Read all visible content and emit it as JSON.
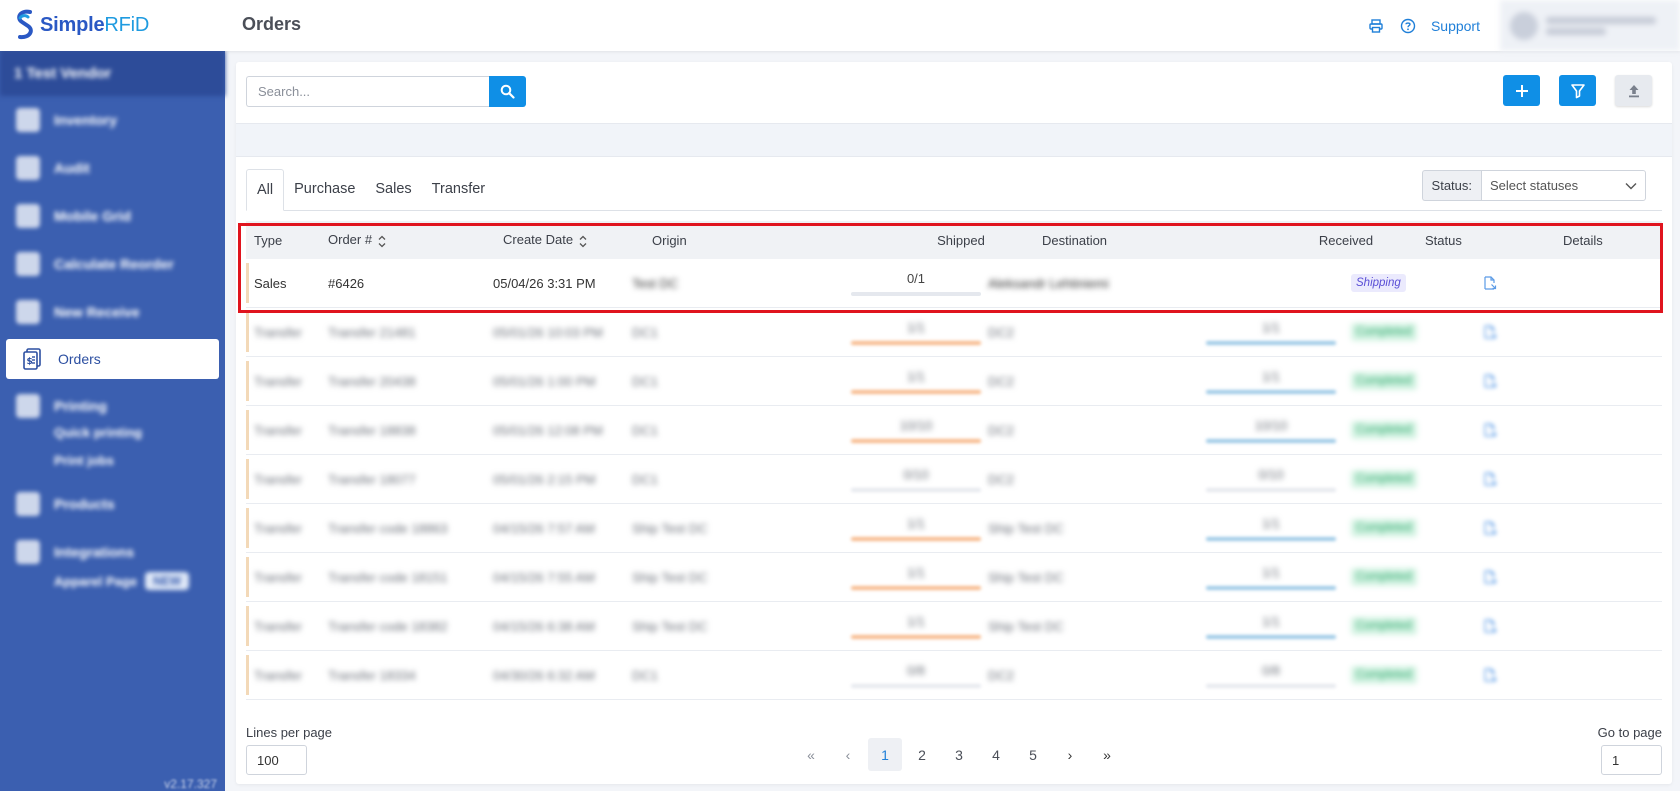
{
  "app": {
    "logo_brand": "Simple",
    "logo_suffix": "RFiD",
    "page_title": "Orders"
  },
  "header": {
    "support_label": "Support",
    "user_name": "Aleksandr Lehtiniemi",
    "user_sub": "Administrator"
  },
  "sidebar": {
    "org_name": "1 Test Vendor",
    "items": [
      {
        "label": "Inventory"
      },
      {
        "label": "Audit"
      },
      {
        "label": "Mobile Grid"
      },
      {
        "label": "Calculate Reorder"
      },
      {
        "label": "New Receive"
      },
      {
        "label": "Orders"
      },
      {
        "label": "Printing"
      },
      {
        "label": "Products"
      },
      {
        "label": "Integrations"
      }
    ],
    "printing_sub": [
      "Quick printing",
      "Print jobs"
    ],
    "integrations_sub": "Apparel Page",
    "integrations_badge": "NEW",
    "version": "v2.17.327"
  },
  "toolbar": {
    "search_placeholder": "Search..."
  },
  "tabs": [
    "All",
    "Purchase",
    "Sales",
    "Transfer"
  ],
  "status_filter": {
    "label": "Status:",
    "placeholder": "Select statuses"
  },
  "table": {
    "headers": [
      "Type",
      "Order #",
      "Create Date",
      "Origin",
      "Shipped",
      "Destination",
      "Received",
      "Status",
      "Details"
    ],
    "rows": [
      {
        "type": "Sales",
        "order": "#6426",
        "date": "05/04/26 3:31 PM",
        "origin": "Test DC",
        "shipped": "0/1",
        "shipped_fill": 0,
        "destination": "Aleksandr Lehtiniemi",
        "received": "",
        "received_fill": null,
        "status": "Shipping",
        "status_kind": "shipping",
        "blurred_text": true
      },
      {
        "type": "Transfer",
        "order": "Transfer 21481",
        "date": "05/01/26 10:03 PM",
        "origin": "DC1",
        "shipped": "1/1",
        "shipped_fill": 1,
        "destination": "DC2",
        "received": "1/1",
        "received_fill": 1,
        "status": "Completed",
        "status_kind": "completed"
      },
      {
        "type": "Transfer",
        "order": "Transfer 20438",
        "date": "05/01/26 1:00 PM",
        "origin": "DC1",
        "shipped": "1/1",
        "shipped_fill": 1,
        "destination": "DC2",
        "received": "1/1",
        "received_fill": 1,
        "status": "Completed",
        "status_kind": "completed"
      },
      {
        "type": "Transfer",
        "order": "Transfer 18838",
        "date": "05/01/26 12:08 PM",
        "origin": "DC1",
        "shipped": "10/10",
        "shipped_fill": 1,
        "destination": "DC2",
        "received": "10/10",
        "received_fill": 1,
        "status": "Completed",
        "status_kind": "completed"
      },
      {
        "type": "Transfer",
        "order": "Transfer 18077",
        "date": "05/01/26 2:15 PM",
        "origin": "DC1",
        "shipped": "0/10",
        "shipped_fill": 0,
        "destination": "DC2",
        "received": "0/10",
        "received_fill": 0,
        "status": "Completed",
        "status_kind": "completed"
      },
      {
        "type": "Transfer",
        "order": "Transfer code 18863",
        "date": "04/15/26 7:57 AM",
        "origin": "Ship Test DC",
        "shipped": "1/1",
        "shipped_fill": 1,
        "destination": "Ship Test DC",
        "received": "1/1",
        "received_fill": 1,
        "status": "Completed",
        "status_kind": "completed"
      },
      {
        "type": "Transfer",
        "order": "Transfer code 18151",
        "date": "04/15/26 7:55 AM",
        "origin": "Ship Test DC",
        "shipped": "1/1",
        "shipped_fill": 1,
        "destination": "Ship Test DC",
        "received": "1/1",
        "received_fill": 1,
        "status": "Completed",
        "status_kind": "completed"
      },
      {
        "type": "Transfer",
        "order": "Transfer code 18382",
        "date": "04/15/26 6:38 AM",
        "origin": "Ship Test DC",
        "shipped": "1/1",
        "shipped_fill": 1,
        "destination": "Ship Test DC",
        "received": "1/1",
        "received_fill": 1,
        "status": "Completed",
        "status_kind": "completed"
      },
      {
        "type": "Transfer",
        "order": "Transfer 18334",
        "date": "04/30/26 6:32 AM",
        "origin": "DC1",
        "shipped": "0/8",
        "shipped_fill": 0,
        "destination": "DC2",
        "received": "0/8",
        "received_fill": 0,
        "status": "Completed",
        "status_kind": "completed"
      }
    ]
  },
  "pagination": {
    "lines_label": "Lines per page",
    "lines_value": "100",
    "pages": [
      "1",
      "2",
      "3",
      "4",
      "5"
    ],
    "current": "1",
    "goto_label": "Go to page",
    "goto_value": "1"
  },
  "colors": {
    "sidebar": "#3b5fb0",
    "primary": "#0f8fe6",
    "shipped_bar": "#f7b98b",
    "received_bar": "#9cc9e6",
    "highlight": "#e0141e"
  }
}
